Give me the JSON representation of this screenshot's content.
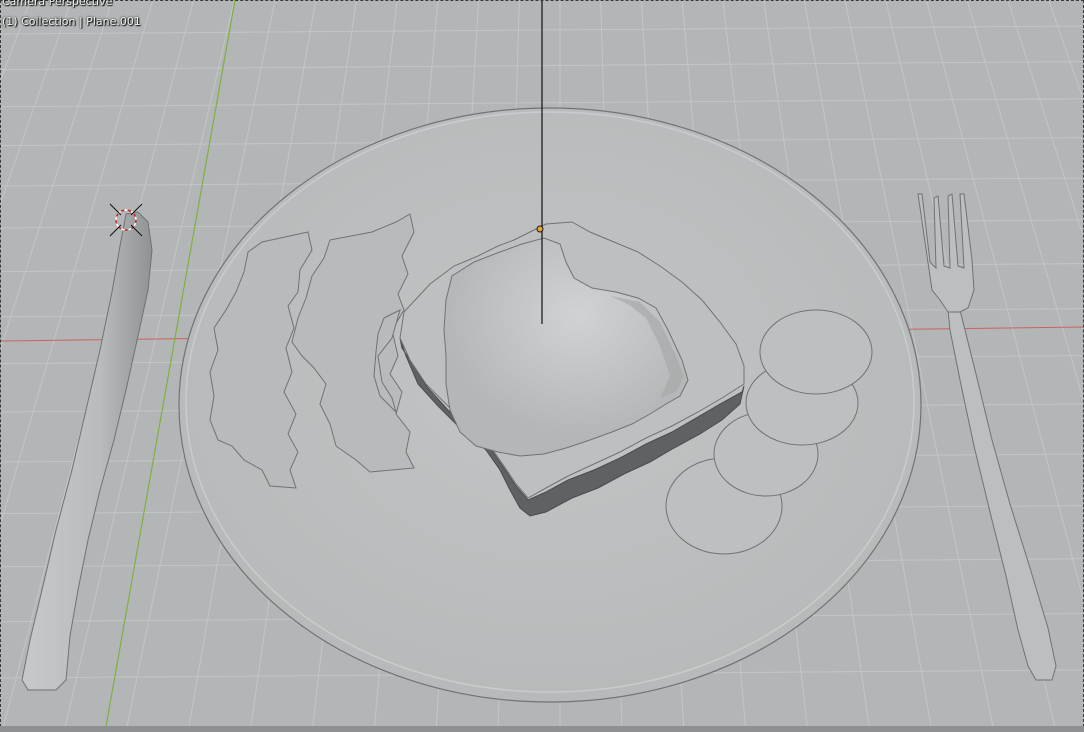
{
  "viewport": {
    "title": "Camera Perspective",
    "info": "(1) Collection | Plane.001"
  },
  "colors": {
    "background": "#b3b6b6",
    "grid": "#c3c6c6",
    "x_axis": "#d06060",
    "y_axis": "#7fb040",
    "outline": "#6f7373",
    "toast_shadow": "#5a5d5d",
    "origin": "#f0a030"
  },
  "icons": {
    "cursor": "3d-cursor-icon",
    "origin": "object-origin-icon"
  }
}
